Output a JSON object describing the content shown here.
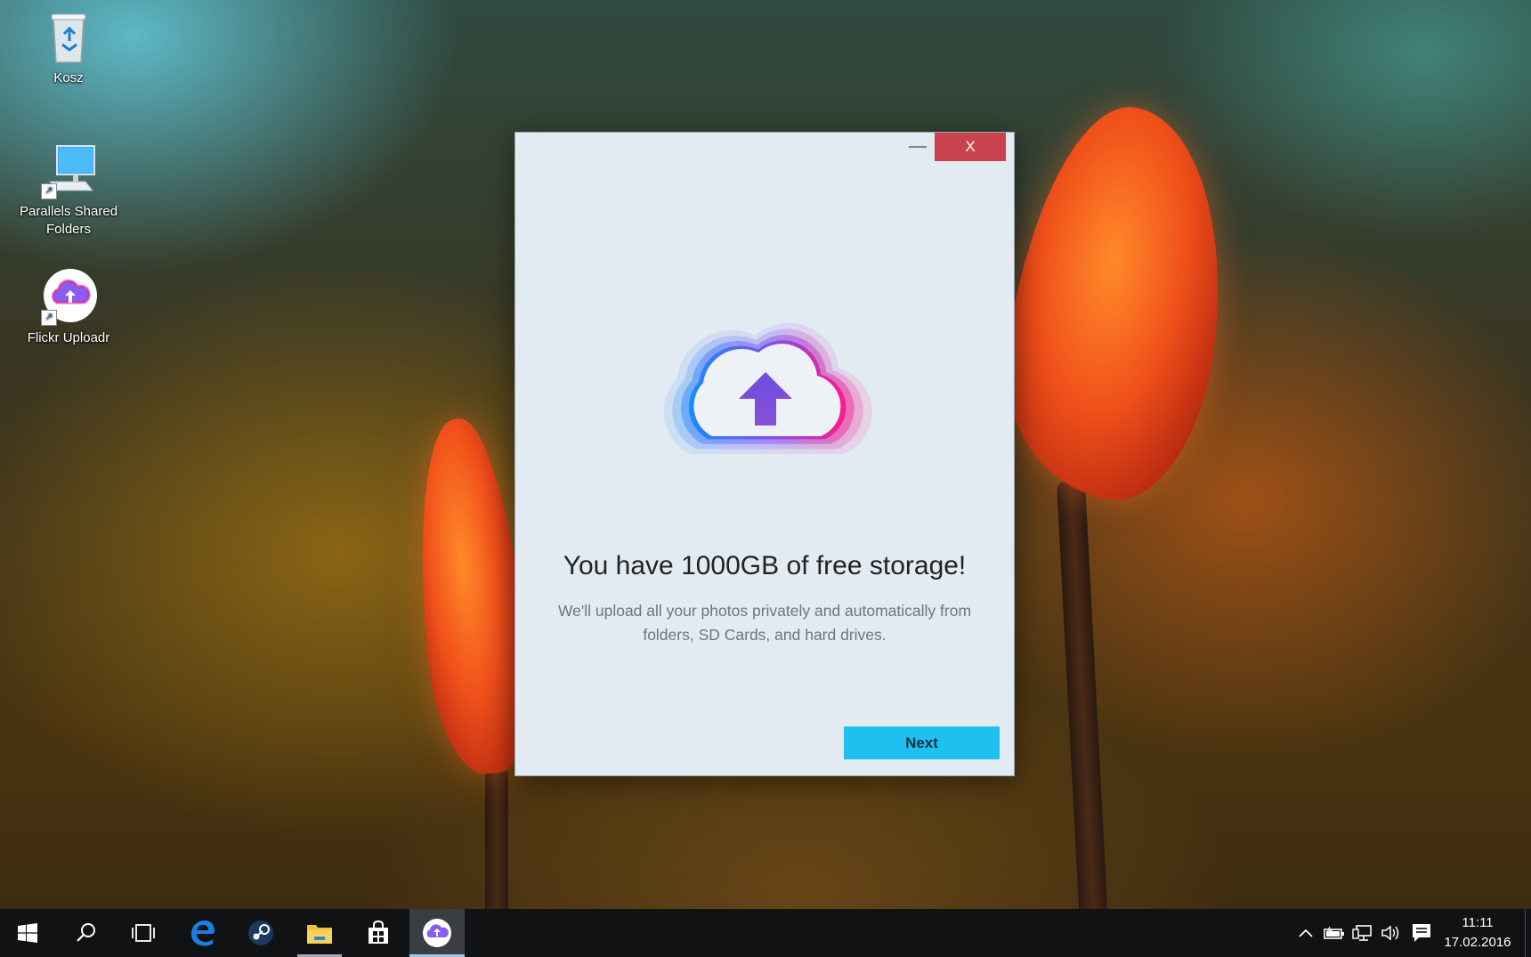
{
  "desktop": {
    "icons": [
      {
        "label": "Kosz",
        "icon": "recycle-bin-icon"
      },
      {
        "label": "Parallels Shared Folders",
        "icon": "computer-shortcut-icon"
      },
      {
        "label": "Flickr Uploadr",
        "icon": "flickr-uploadr-icon"
      }
    ]
  },
  "dialog": {
    "minimize_icon": "minimize-icon",
    "close_label": "X",
    "headline": "You have 1000GB of free storage!",
    "subtext_line1": "We'll upload all your photos privately and automatically from",
    "subtext_line2": "folders, SD Cards, and hard drives.",
    "next_label": "Next",
    "hero_icon": "cloud-upload-icon"
  },
  "taskbar": {
    "buttons": [
      {
        "icon": "windows-start-icon"
      },
      {
        "icon": "search-icon"
      },
      {
        "icon": "task-view-icon"
      },
      {
        "icon": "edge-icon"
      },
      {
        "icon": "steam-icon"
      },
      {
        "icon": "file-explorer-icon"
      },
      {
        "icon": "store-icon"
      },
      {
        "icon": "flickr-uploadr-icon"
      }
    ],
    "tray": [
      {
        "icon": "chevron-up-icon"
      },
      {
        "icon": "battery-icon"
      },
      {
        "icon": "network-icon"
      },
      {
        "icon": "volume-icon"
      },
      {
        "icon": "action-center-icon"
      }
    ],
    "time": "11:11",
    "date": "17.02.2016"
  },
  "colors": {
    "close_button": "#c8434e",
    "next_button": "#1ec0f0",
    "dialog_background": "#e3ebf2",
    "taskbar": "#101214"
  }
}
